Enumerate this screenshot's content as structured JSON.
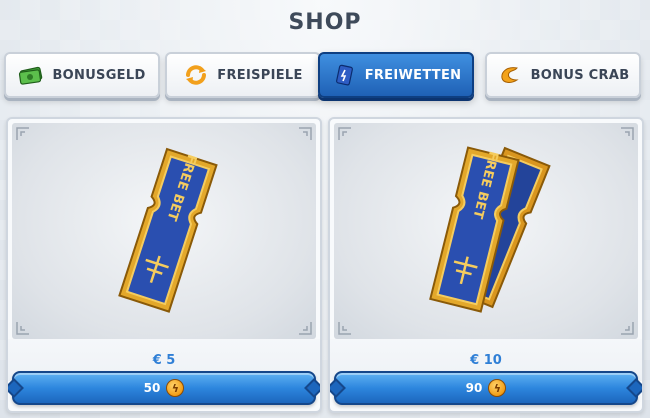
{
  "header": {
    "title": "SHOP"
  },
  "tabs": [
    {
      "label": "BONUSGELD",
      "icon": "cash-icon",
      "active": false
    },
    {
      "label": "FREISPIELE",
      "icon": "refresh-icon",
      "active": false
    },
    {
      "label": "FREIWETTEN",
      "icon": "ticket-card-icon",
      "active": true
    },
    {
      "label": "BONUS CRAB",
      "icon": "crab-claw-icon",
      "active": false
    }
  ],
  "offers": [
    {
      "ticket_text": "FREE BET",
      "price_label": "€ 5",
      "cost": "50",
      "currency_icon": "lightning-coin-icon"
    },
    {
      "ticket_text": "FREE BET",
      "price_label": "€ 10",
      "cost": "90",
      "currency_icon": "lightning-coin-icon"
    }
  ],
  "colors": {
    "accent": "#2d86de",
    "active_tab": "#1f61b6",
    "price_text": "#2f7fd6",
    "ticket_gold": "#e3a82b",
    "ticket_blue": "#2a4fb0"
  }
}
